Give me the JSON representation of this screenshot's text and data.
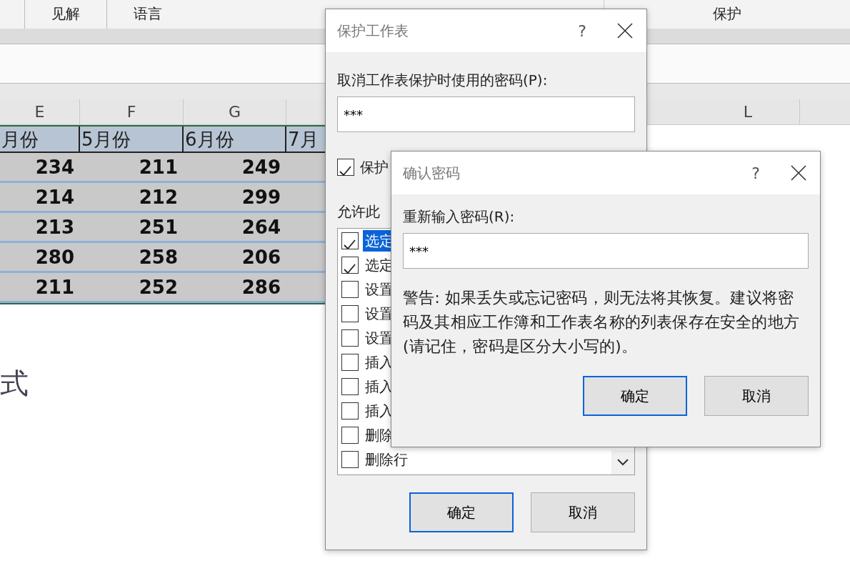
{
  "ribbon": {
    "tabs": [
      "见解",
      "语言"
    ],
    "right_group": "保护"
  },
  "sheet": {
    "column_headers": [
      "E",
      "F",
      "G",
      "L"
    ],
    "header_row": [
      "月份",
      "5月份",
      "6月份",
      "7月"
    ],
    "rows": [
      [
        "234",
        "211",
        "249"
      ],
      [
        "214",
        "212",
        "299"
      ],
      [
        "213",
        "251",
        "264"
      ],
      [
        "280",
        "258",
        "206"
      ],
      [
        "211",
        "252",
        "286"
      ]
    ],
    "caption": "式"
  },
  "protect_dialog": {
    "title": "保护工作表",
    "help": "?",
    "password_label": "取消工作表保护时使用的密码(P):",
    "password_value": "***",
    "protect_option": {
      "label": "保护",
      "checked": true
    },
    "allow_label": "允许此",
    "permissions": [
      {
        "label": "选定",
        "checked": true,
        "selected": true
      },
      {
        "label": "选定",
        "checked": true,
        "selected": false
      },
      {
        "label": "设置",
        "checked": false,
        "selected": false
      },
      {
        "label": "设置",
        "checked": false,
        "selected": false
      },
      {
        "label": "设置",
        "checked": false,
        "selected": false
      },
      {
        "label": "插入",
        "checked": false,
        "selected": false
      },
      {
        "label": "插入",
        "checked": false,
        "selected": false
      },
      {
        "label": "插入",
        "checked": false,
        "selected": false
      },
      {
        "label": "删除",
        "checked": false,
        "selected": false
      },
      {
        "label": "删除行",
        "checked": false,
        "selected": false
      }
    ],
    "buttons": [
      {
        "label": "确定",
        "default": true
      },
      {
        "label": "取消",
        "default": false
      }
    ]
  },
  "confirm_dialog": {
    "title": "确认密码",
    "help": "?",
    "password_label": "重新输入密码(R):",
    "password_value": "***",
    "warning": "警告: 如果丢失或忘记密码，则无法将其恢复。建议将密码及其相应工作簿和工作表名称的列表保存在安全的地方(请记住，密码是区分大小写的)。",
    "buttons": [
      {
        "label": "确定",
        "default": true
      },
      {
        "label": "取消",
        "default": false
      }
    ]
  }
}
